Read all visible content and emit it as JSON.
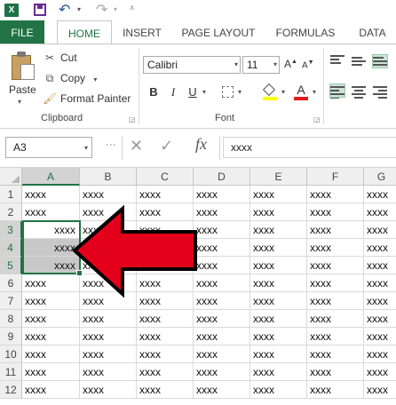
{
  "qat": {
    "app_icon_text": "X"
  },
  "tabs": [
    "FILE",
    "HOME",
    "INSERT",
    "PAGE LAYOUT",
    "FORMULAS",
    "DATA"
  ],
  "clipboard": {
    "paste": "Paste",
    "cut": "Cut",
    "copy": "Copy",
    "format_painter": "Format Painter",
    "group_label": "Clipboard"
  },
  "font": {
    "name": "Calibri",
    "size": "11",
    "bold": "B",
    "italic": "I",
    "underline": "U",
    "color_glyph": "A",
    "grow_glyph": "A",
    "shrink_glyph": "A",
    "group_label": "Font"
  },
  "formula_bar": {
    "name_box": "A3",
    "cancel": "✕",
    "enter": "✓",
    "fx": "fx",
    "value": "xxxx"
  },
  "grid": {
    "columns": [
      "A",
      "B",
      "C",
      "D",
      "E",
      "F",
      "G"
    ],
    "rows": [
      "1",
      "2",
      "3",
      "4",
      "5",
      "6",
      "7",
      "8",
      "9",
      "10",
      "11",
      "12"
    ],
    "cell_text": "xxxx",
    "selected_column": "A",
    "selected_rows": [
      "3",
      "4",
      "5"
    ],
    "active_cell": "A3"
  },
  "colors": {
    "accent": "#217346",
    "arrow_red": "#e2001a",
    "fill_yellow": "#ffff00",
    "font_red": "#e21c1c"
  },
  "icons": [
    "excel-logo-icon",
    "save-icon",
    "undo-icon",
    "redo-icon",
    "customize-qat-icon",
    "paste-icon",
    "cut-icon",
    "copy-icon",
    "format-painter-icon",
    "bold-icon",
    "italic-icon",
    "underline-icon",
    "borders-icon",
    "fill-color-icon",
    "font-color-icon",
    "align-top-icon",
    "align-middle-icon",
    "align-bottom-icon",
    "align-left-icon",
    "align-center-icon",
    "align-right-icon",
    "name-box-dropdown-icon",
    "cancel-icon",
    "enter-icon",
    "insert-function-icon",
    "select-all-icon"
  ]
}
